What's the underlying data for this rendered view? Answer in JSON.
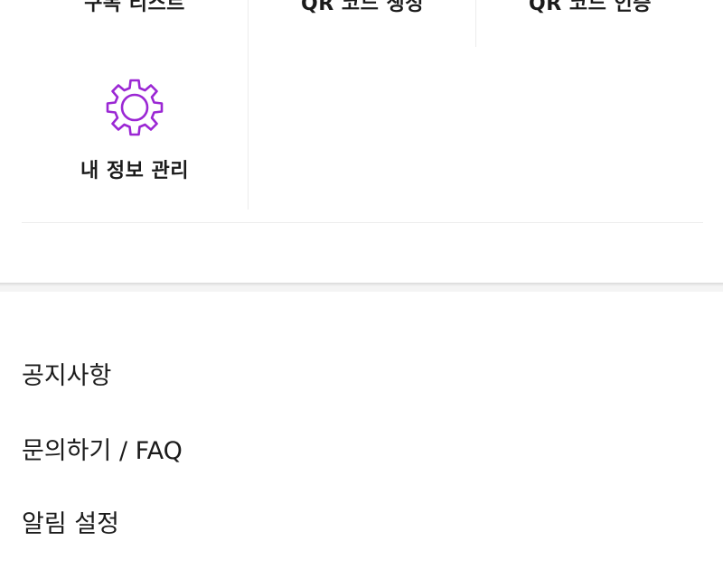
{
  "grid": {
    "row1": [
      {
        "label": "구독 리스트"
      },
      {
        "label": "QR 코드 생성"
      },
      {
        "label": "QR 코드 인증"
      }
    ],
    "profile": {
      "label": "내 정보 관리",
      "icon": "gear-icon",
      "icon_color": "#9b27d4"
    }
  },
  "menu": {
    "notice": "공지사항",
    "inquiry": "문의하기 / FAQ",
    "notification": "알림 설정"
  }
}
